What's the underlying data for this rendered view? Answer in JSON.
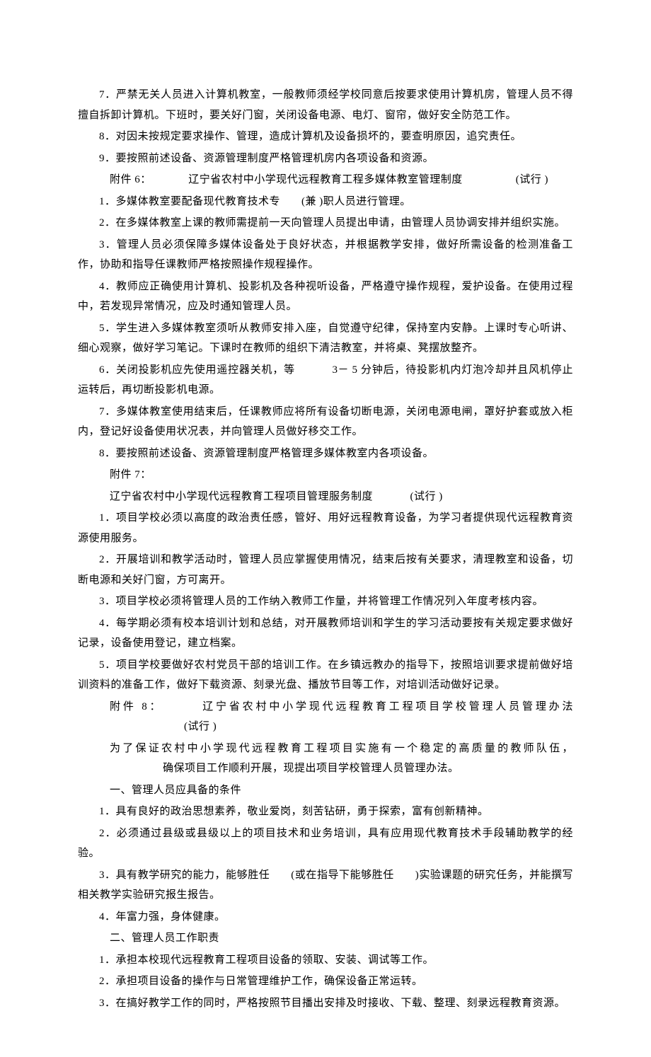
{
  "p": [
    {
      "cls": "para",
      "text": "7．严禁无关人员进入计算机教室，一般教师须经学校同意后按要求使用计算机房，管理人员不得擅自拆卸计算机。下班时，要关好门窗，关闭设备电源、电灯、窗帘，做好安全防范工作。"
    },
    {
      "cls": "para",
      "text": "8．对因未按规定要求操作、管理，造成计算机及设备损坏的，要查明原因，追究责任。"
    },
    {
      "cls": "para",
      "text": "9．要按照前述设备、资源管理制度严格管理机房内各项设备和资源。"
    },
    {
      "cls": "para-deep",
      "segments": [
        {
          "t": "附件 6：",
          "gap": "g2"
        },
        {
          "t": "辽宁省农村中小学现代远程教育工程多媒体教室管理制度",
          "gap": "g3"
        },
        {
          "t": "(试行 )"
        }
      ]
    },
    {
      "cls": "para",
      "segments": [
        {
          "t": "1．多媒体教室要配备现代教育技术专",
          "gap": "g1"
        },
        {
          "t": "(兼 )职人员进行管理。"
        }
      ]
    },
    {
      "cls": "para",
      "text": "2．在多媒体教室上课的教师需提前一天向管理人员提出申请，由管理人员协调安排并组织实施。"
    },
    {
      "cls": "para",
      "text": "3．管理人员必须保障多媒体设备处于良好状态，并根据教学安排，做好所需设备的检测准备工作，协助和指导任课教师严格按照操作规程操作。"
    },
    {
      "cls": "para",
      "text": "4．教师应正确使用计算机、投影机及各种视听设备，严格遵守操作规程，爱护设备。在使用过程中，若发现异常情况，应及时通知管理人员。"
    },
    {
      "cls": "para",
      "text": "5．学生进入多媒体教室须听从教师安排入座，自觉遵守纪律，保持室内安静。上课时专心听讲、细心观察，做好学习笔记。下课时在教师的组织下清洁教室，并将桌、凳摆放整齐。"
    },
    {
      "cls": "para",
      "segments": [
        {
          "t": "6．关闭投影机应先使用遥控器关机，等",
          "gap": "g2"
        },
        {
          "t": "3－ 5 分钟后，待投影机内灯泡冷却并且风机停止运转后，再切断投影机电源。"
        }
      ]
    },
    {
      "cls": "para",
      "text": "7．多媒体教室使用结束后，任课教师应将所有设备切断电源，关闭电源电闸，罩好护套或放入柜内，登记好设备使用状况表，并向管理人员做好移交工作。"
    },
    {
      "cls": "para",
      "text": "8．要按照前述设备、资源管理制度严格管理多媒体教室内各项设备。"
    },
    {
      "cls": "para-deep",
      "text": "附件 7："
    },
    {
      "cls": "para-deep",
      "segments": [
        {
          "t": "辽宁省农村中小学现代远程教育工程项目管理服务制度",
          "gap": "g2"
        },
        {
          "t": "(试行 )"
        }
      ]
    },
    {
      "cls": "para",
      "text": "1．项目学校必须以高度的政治责任感，管好、用好远程教育设备，为学习者提供现代远程教育资源使用服务。"
    },
    {
      "cls": "para",
      "text": "2．开展培训和教学活动时，管理人员应掌握使用情况，结束后按有关要求，清理教室和设备，切断电源和关好门窗，方可离开。"
    },
    {
      "cls": "para",
      "text": "3．项目学校必须将管理人员的工作纳入教师工作量，并将管理工作情况列入年度考核内容。"
    },
    {
      "cls": "para",
      "text": "4．每学期必须有校本培训计划和总结，对开展教师培训和学生的学习活动要按有关规定要求做好记录，设备使用登记，建立档案。"
    },
    {
      "cls": "para",
      "text": "5．项目学校要做好农村党员干部的培训工作。在乡镇远教办的指导下，按照培训要求提前做好培训资料的准备工作，做好下载资源、刻录光盘、播放节目等工作，对培训活动做好记录。"
    },
    {
      "cls": "para-deep",
      "segments": [
        {
          "t": "附件   8：",
          "gap": "g2"
        },
        {
          "t": "辽宁省农村中小学现代远程教育工程项目学校管理人员管理办法",
          "gap": "g5"
        },
        {
          "t": "(试行 )"
        }
      ]
    },
    {
      "cls": "para-deep",
      "segments": [
        {
          "t": "为了保证农村中小学现代远程教育工程项目实施有一个稳定的高质量的教师队伍，",
          "gap": "g4"
        },
        {
          "t": "确保项目工作顺利开展，现提出项目学校管理人员管理办法。"
        }
      ]
    },
    {
      "cls": "para-deep",
      "text": "一、管理人员应具备的条件"
    },
    {
      "cls": "para",
      "text": "1．具有良好的政治思想素养，敬业爱岗，刻苦钻研，勇于探索，富有创新精神。"
    },
    {
      "cls": "para",
      "text": "2．必须通过县级或县级以上的项目技术和业务培训，具有应用现代教育技术手段辅助教学的经验。"
    },
    {
      "cls": "para",
      "segments": [
        {
          "t": "3．具有教学研究的能力，能够胜任",
          "gap": "g1"
        },
        {
          "t": "(或在指导下能够胜任",
          "gap": "g1"
        },
        {
          "t": ")实验课题的研究任务，并能撰写相关教学实验研究报生报告。"
        }
      ]
    },
    {
      "cls": "para",
      "text": "4．年富力强，身体健康。"
    },
    {
      "cls": "para-deep",
      "text": "二、管理人员工作职责"
    },
    {
      "cls": "para",
      "text": "1．承担本校现代远程教育工程项目设备的领取、安装、调试等工作。"
    },
    {
      "cls": "para",
      "text": "2．承担项目设备的操作与日常管理维护工作，确保设备正常运转。"
    },
    {
      "cls": "para",
      "text": "3．在搞好教学工作的同时，严格按照节目播出安排及时接收、下载、整理、刻录远程教育资源。"
    }
  ]
}
